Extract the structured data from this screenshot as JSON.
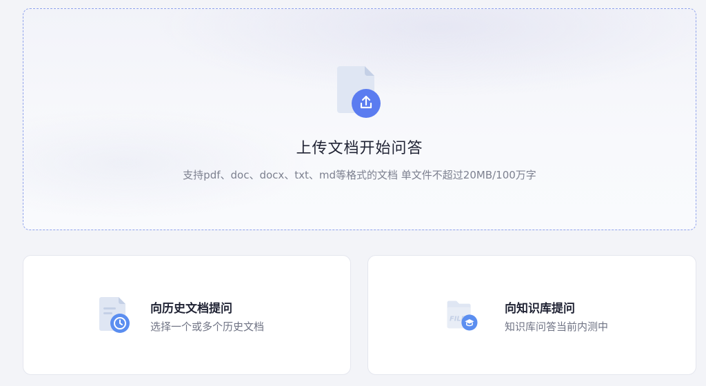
{
  "upload": {
    "title": "上传文档开始问答",
    "subtitle": "支持pdf、doc、docx、txt、md等格式的文档 单文件不超过20MB/100万字",
    "icon": "file-upload-icon"
  },
  "cards": [
    {
      "title": "向历史文档提问",
      "description": "选择一个或多个历史文档",
      "icon": "document-history-icon"
    },
    {
      "title": "向知识库提问",
      "description": "知识库问答当前内测中",
      "icon": "knowledge-base-folder-icon",
      "icon_text": "FILE"
    }
  ],
  "colors": {
    "accent": "#5b7cf0",
    "icon_light": "#dfe6f3",
    "border_dashed": "#8fa2ec"
  }
}
